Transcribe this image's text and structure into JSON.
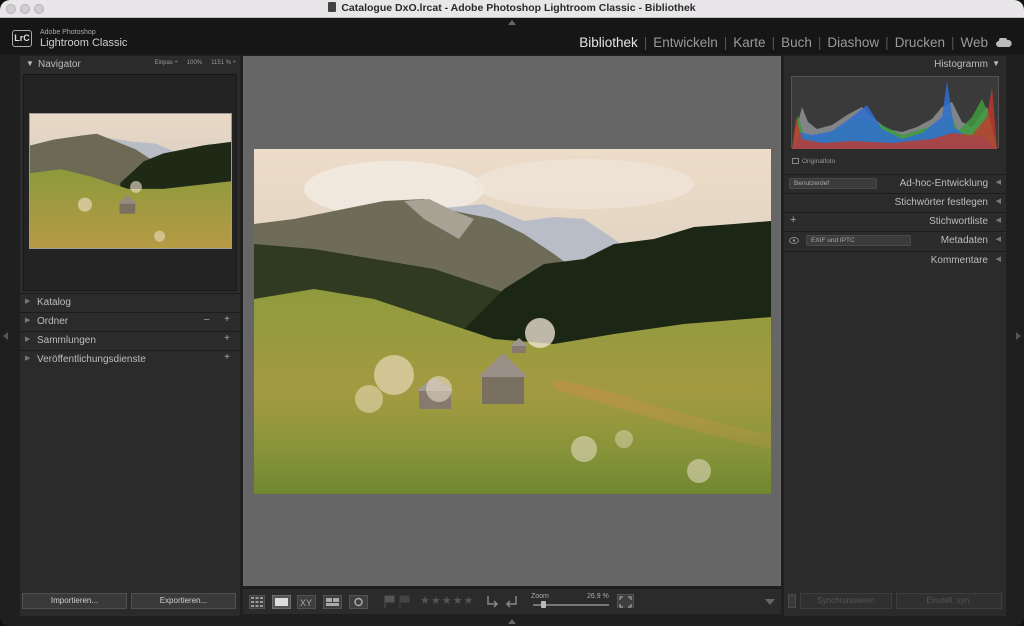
{
  "window": {
    "title": "Catalogue DxO.lrcat - Adobe Photoshop Lightroom Classic - Bibliothek"
  },
  "app": {
    "badge": "LrC",
    "vendor": "Adobe Photoshop",
    "product": "Lightroom Classic"
  },
  "modules": [
    "Bibliothek",
    "Entwickeln",
    "Karte",
    "Buch",
    "Diashow",
    "Drucken",
    "Web"
  ],
  "active_module": "Bibliothek",
  "left": {
    "navigator": {
      "label": "Navigator",
      "opt_fit": "Einpas ÷",
      "opt_100": "100%",
      "opt_zoom": "1151 % ÷"
    },
    "panels": [
      {
        "label": "Katalog",
        "actions": ""
      },
      {
        "label": "Ordner",
        "actions": "– +"
      },
      {
        "label": "Sammlungen",
        "actions": "+"
      },
      {
        "label": "Veröffentlichungsdienste",
        "actions": "+"
      }
    ],
    "import_label": "Importieren...",
    "export_label": "Exportieren..."
  },
  "toolbar": {
    "zoom_label": "Zoom",
    "zoom_value": "26.9 %",
    "stars": "★★★★★",
    "zoom_level": 0.1
  },
  "right": {
    "histogram": {
      "label": "Histogramm",
      "original_label": "Originalfoto"
    },
    "quick_develop": {
      "label": "Ad-hoc-Entwicklung",
      "preset": "Benutzerdef"
    },
    "keywording": {
      "label": "Stichwörter festlegen"
    },
    "keyword_list": {
      "label": "Stichwortliste"
    },
    "metadata": {
      "label": "Metadaten",
      "preset": "EXIF und IPTC"
    },
    "comments": {
      "label": "Kommentare"
    },
    "sync_label": "Synchronisieren",
    "auto_sync_label": "Einstell. syn."
  },
  "colors": {
    "panel": "#2b2b2b",
    "canvas": "#666666",
    "accent": "#e6e6e6"
  }
}
